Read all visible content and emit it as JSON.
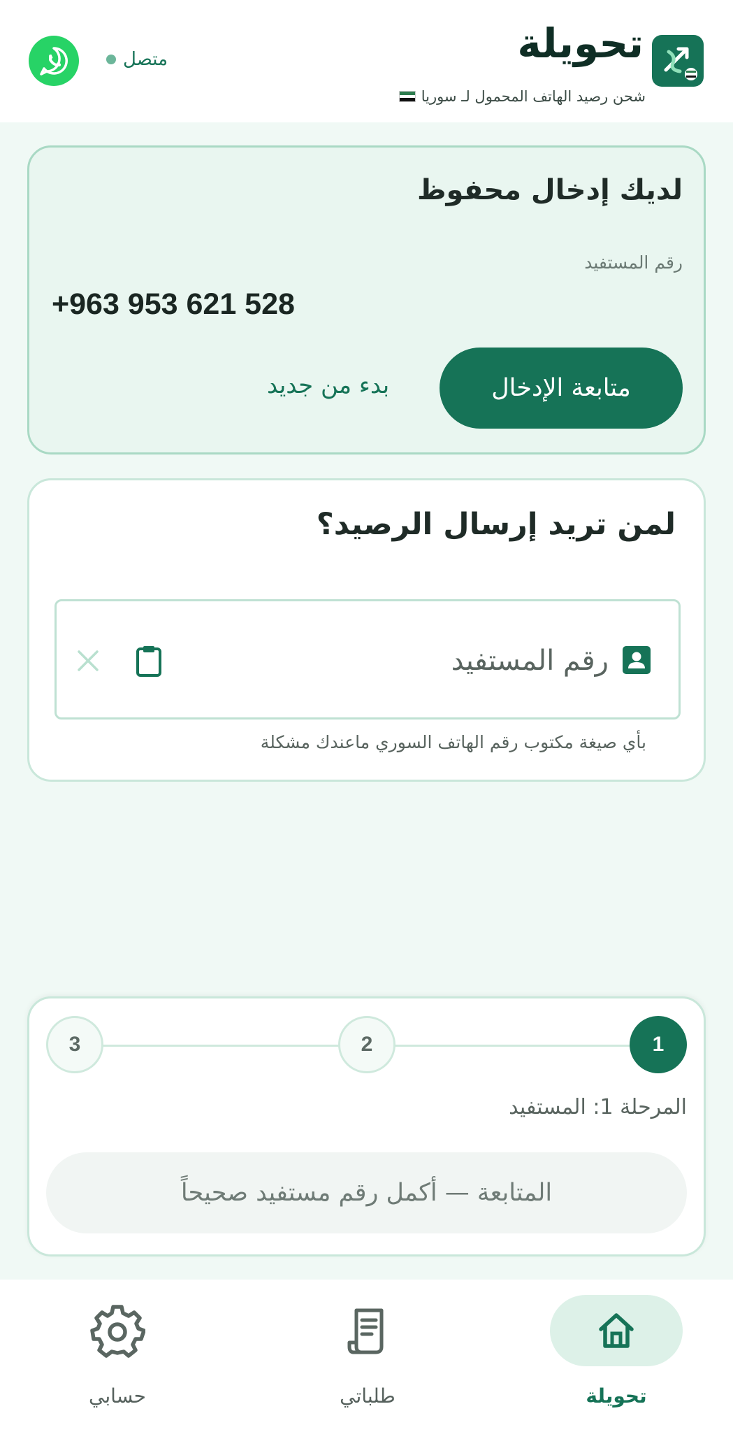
{
  "header": {
    "app_title": "تحويلة",
    "subtitle": "شحن رصيد الهاتف المحمول لـ سوريا",
    "status": "متصل",
    "logo_icon": "transfer-logo-icon",
    "whatsapp_icon": "whatsapp-icon"
  },
  "saved_entry": {
    "title": "لديك إدخال محفوظ",
    "beneficiary_label": "رقم المستفيد",
    "phone_number": "+963 953 621 528",
    "continue_label": "متابعة الإدخال",
    "restart_label": "بدء من جديد"
  },
  "recipient": {
    "question": "لمن تريد إرسال الرصيد؟",
    "phone_placeholder": "رقم المستفيد",
    "phone_value": "",
    "hint": "بأي صيغة مكتوب رقم الهاتف السوري ماعندك مشكلة"
  },
  "progress": {
    "steps": [
      "1",
      "2",
      "3"
    ],
    "current_step": 1,
    "stage_label": "المرحلة 1: المستفيد",
    "proceed_label": "المتابعة — أكمل رقم مستفيد صحيحاً"
  },
  "bottom_nav": {
    "items": [
      {
        "label": "تحويلة",
        "icon": "home-icon",
        "active": true
      },
      {
        "label": "طلباتي",
        "icon": "receipt-icon",
        "active": false
      },
      {
        "label": "حسابي",
        "icon": "gear-icon",
        "active": false
      }
    ]
  },
  "colors": {
    "primary": "#167357",
    "background": "#f0f9f5",
    "card_border": "#c9e7da",
    "whatsapp": "#27d366"
  }
}
